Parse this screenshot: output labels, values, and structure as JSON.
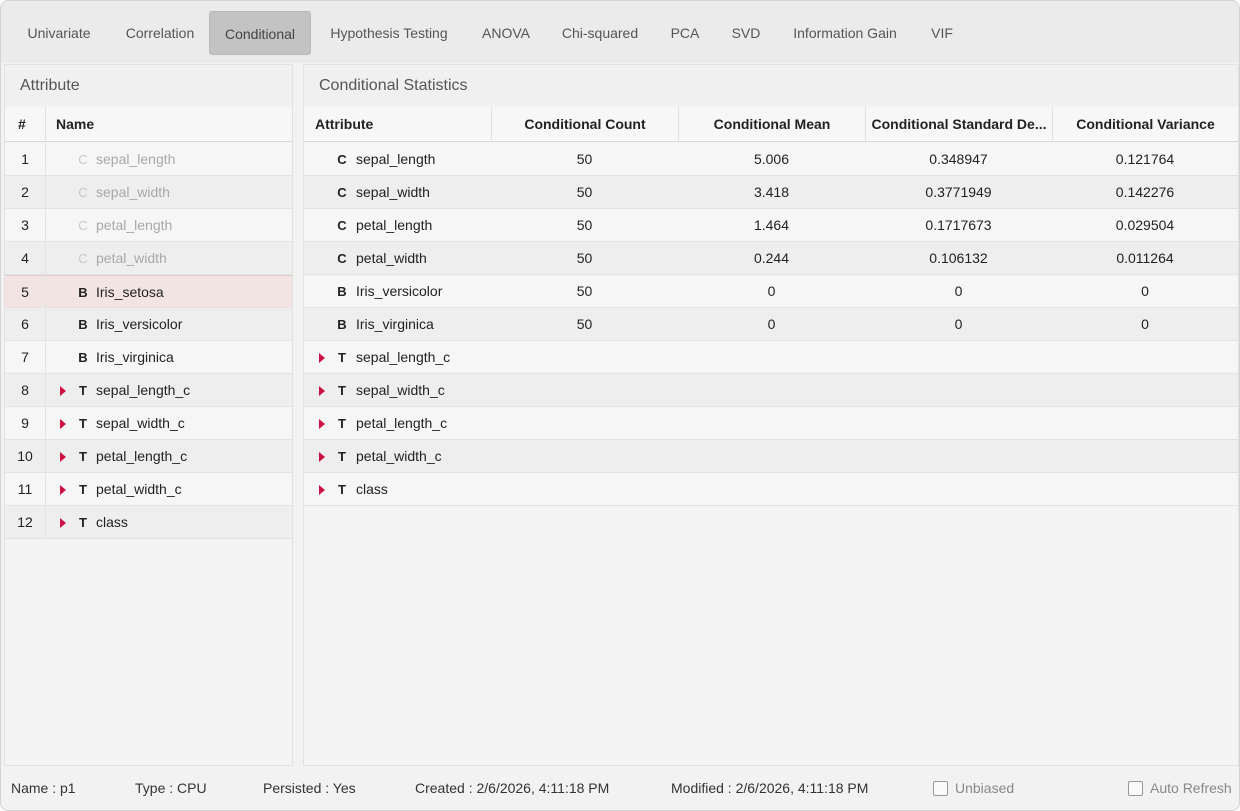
{
  "tabs": [
    "Univariate",
    "Correlation",
    "Conditional",
    "Hypothesis Testing",
    "ANOVA",
    "Chi-squared",
    "PCA",
    "SVD",
    "Information Gain",
    "VIF"
  ],
  "active_tab": "Conditional",
  "left_panel": {
    "title": "Attribute",
    "headers": {
      "index": "#",
      "name": "Name"
    },
    "rows": [
      {
        "index": "1",
        "type": "C",
        "name": "sepal_length",
        "dimmed": true,
        "expandable": false
      },
      {
        "index": "2",
        "type": "C",
        "name": "sepal_width",
        "dimmed": true,
        "expandable": false
      },
      {
        "index": "3",
        "type": "C",
        "name": "petal_length",
        "dimmed": true,
        "expandable": false
      },
      {
        "index": "4",
        "type": "C",
        "name": "petal_width",
        "dimmed": true,
        "expandable": false
      },
      {
        "index": "5",
        "type": "B",
        "name": "Iris_setosa",
        "dimmed": false,
        "expandable": false,
        "selected": true
      },
      {
        "index": "6",
        "type": "B",
        "name": "Iris_versicolor",
        "dimmed": false,
        "expandable": false
      },
      {
        "index": "7",
        "type": "B",
        "name": "Iris_virginica",
        "dimmed": false,
        "expandable": false
      },
      {
        "index": "8",
        "type": "T",
        "name": "sepal_length_c",
        "dimmed": false,
        "expandable": true
      },
      {
        "index": "9",
        "type": "T",
        "name": "sepal_width_c",
        "dimmed": false,
        "expandable": true
      },
      {
        "index": "10",
        "type": "T",
        "name": "petal_length_c",
        "dimmed": false,
        "expandable": true
      },
      {
        "index": "11",
        "type": "T",
        "name": "petal_width_c",
        "dimmed": false,
        "expandable": true
      },
      {
        "index": "12",
        "type": "T",
        "name": "class",
        "dimmed": false,
        "expandable": true
      }
    ]
  },
  "right_panel": {
    "title": "Conditional Statistics",
    "headers": [
      "Attribute",
      "Conditional Count",
      "Conditional Mean",
      "Conditional Standard De...",
      "Conditional Variance"
    ],
    "rows": [
      {
        "type": "C",
        "name": "sepal_length",
        "expandable": false,
        "values": [
          "50",
          "5.006",
          "0.348947",
          "0.121764"
        ]
      },
      {
        "type": "C",
        "name": "sepal_width",
        "expandable": false,
        "values": [
          "50",
          "3.418",
          "0.3771949",
          "0.142276"
        ]
      },
      {
        "type": "C",
        "name": "petal_length",
        "expandable": false,
        "values": [
          "50",
          "1.464",
          "0.1717673",
          "0.029504"
        ]
      },
      {
        "type": "C",
        "name": "petal_width",
        "expandable": false,
        "values": [
          "50",
          "0.244",
          "0.106132",
          "0.011264"
        ]
      },
      {
        "type": "B",
        "name": "Iris_versicolor",
        "expandable": false,
        "values": [
          "50",
          "0",
          "0",
          "0"
        ]
      },
      {
        "type": "B",
        "name": "Iris_virginica",
        "expandable": false,
        "values": [
          "50",
          "0",
          "0",
          "0"
        ]
      },
      {
        "type": "T",
        "name": "sepal_length_c",
        "expandable": true,
        "values": [
          "",
          "",
          "",
          ""
        ]
      },
      {
        "type": "T",
        "name": "sepal_width_c",
        "expandable": true,
        "values": [
          "",
          "",
          "",
          ""
        ]
      },
      {
        "type": "T",
        "name": "petal_length_c",
        "expandable": true,
        "values": [
          "",
          "",
          "",
          ""
        ]
      },
      {
        "type": "T",
        "name": "petal_width_c",
        "expandable": true,
        "values": [
          "",
          "",
          "",
          ""
        ]
      },
      {
        "type": "T",
        "name": "class",
        "expandable": true,
        "values": [
          "",
          "",
          "",
          ""
        ]
      }
    ]
  },
  "status": {
    "name": "Name : p1",
    "type": "Type : CPU",
    "persisted": "Persisted : Yes",
    "created": "Created : 2/6/2026, 4:11:18 PM",
    "modified": "Modified : 2/6/2026, 4:11:18 PM",
    "unbiased_label": "Unbiased",
    "unbiased_checked": false,
    "auto_refresh_label": "Auto Refresh",
    "auto_refresh_checked": false
  },
  "colors": {
    "accent_caret": "#cc1144",
    "selected_row": "#f3e4e4"
  },
  "icons": {
    "expand": "caret-right-icon"
  }
}
